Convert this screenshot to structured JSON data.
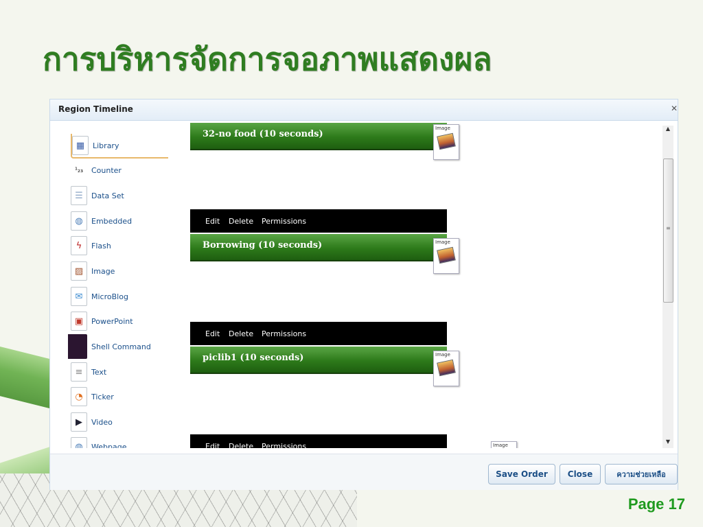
{
  "slide": {
    "title": "การบริหารจัดการจอภาพแสดงผล",
    "page_label": "Page 17"
  },
  "dialog": {
    "title": "Region Timeline"
  },
  "toolbox": {
    "items": [
      {
        "label": "Library",
        "icon": "library-icon",
        "selected": true
      },
      {
        "label": "Counter",
        "icon": "counter-icon"
      },
      {
        "label": "Data Set",
        "icon": "dataset-icon"
      },
      {
        "label": "Embedded",
        "icon": "embedded-icon"
      },
      {
        "label": "Flash",
        "icon": "flash-icon"
      },
      {
        "label": "Image",
        "icon": "image-icon"
      },
      {
        "label": "MicroBlog",
        "icon": "microblog-icon"
      },
      {
        "label": "PowerPoint",
        "icon": "powerpoint-icon"
      },
      {
        "label": "Shell Command",
        "icon": "shell-command-icon"
      },
      {
        "label": "Text",
        "icon": "text-icon"
      },
      {
        "label": "Ticker",
        "icon": "ticker-icon"
      },
      {
        "label": "Video",
        "icon": "video-icon"
      },
      {
        "label": "Webpage",
        "icon": "webpage-icon"
      }
    ]
  },
  "timeline": {
    "media": [
      {
        "name": "32-no food (10 seconds)",
        "thumb_label": "Image"
      },
      {
        "name": "Borrowing (10 seconds)",
        "thumb_label": "Image"
      },
      {
        "name": "piclib1 (10 seconds)",
        "thumb_label": "Image"
      }
    ],
    "actions": {
      "edit": "Edit",
      "delete": "Delete",
      "permissions": "Permissions"
    },
    "next_thumb_label": "Image"
  },
  "footer": {
    "save_order": "Save Order",
    "close": "Close",
    "help": "ความช่วยเหลือ"
  },
  "colors": {
    "title_green": "#2f7d21",
    "region_green": "#2d7a1a",
    "page_green": "#1f9a1f"
  }
}
